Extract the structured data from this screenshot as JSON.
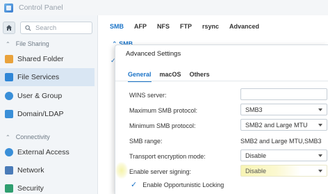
{
  "window": {
    "title": "Control Panel"
  },
  "search": {
    "placeholder": "Search"
  },
  "sidebar": {
    "sections": [
      {
        "label": "File Sharing"
      },
      {
        "label": "Connectivity"
      }
    ],
    "items": [
      {
        "label": "Shared Folder",
        "icon": "shared-folder-icon",
        "color": "#e9a23b"
      },
      {
        "label": "File Services",
        "icon": "file-services-icon",
        "color": "#2f86d6"
      },
      {
        "label": "User & Group",
        "icon": "user-group-icon",
        "color": "#3a8fd8"
      },
      {
        "label": "Domain/LDAP",
        "icon": "domain-ldap-icon",
        "color": "#3a8fd8"
      },
      {
        "label": "External Access",
        "icon": "external-access-icon",
        "color": "#3a8fd8"
      },
      {
        "label": "Network",
        "icon": "network-icon",
        "color": "#4a7bb8"
      },
      {
        "label": "Security",
        "icon": "security-icon",
        "color": "#2f9e6f"
      }
    ],
    "active_item": "File Services"
  },
  "main": {
    "tabs": [
      {
        "label": "SMB"
      },
      {
        "label": "AFP"
      },
      {
        "label": "NFS"
      },
      {
        "label": "FTP"
      },
      {
        "label": "rsync"
      },
      {
        "label": "Advanced"
      }
    ],
    "active_tab": "SMB",
    "background_heading": "SMB"
  },
  "dialog": {
    "title": "Advanced Settings",
    "tabs": [
      {
        "label": "General"
      },
      {
        "label": "macOS"
      },
      {
        "label": "Others"
      }
    ],
    "active_tab": "General",
    "fields": {
      "wins_label": "WINS server:",
      "wins_value": "",
      "max_smb_label": "Maximum SMB protocol:",
      "max_smb_value": "SMB3",
      "min_smb_label": "Minimum SMB protocol:",
      "min_smb_value": "SMB2 and Large MTU",
      "smb_range_label": "SMB range:",
      "smb_range_value": "SMB2 and Large MTU,SMB3",
      "transport_label": "Transport encryption mode:",
      "transport_value": "Disable",
      "signing_label": "Enable server signing:",
      "signing_value": "Disable",
      "oplock_label": "Enable Opportunistic Locking",
      "oplock_checked": true
    },
    "accent_color": "#1a73c7",
    "highlight_color": "#f7f4b4"
  }
}
